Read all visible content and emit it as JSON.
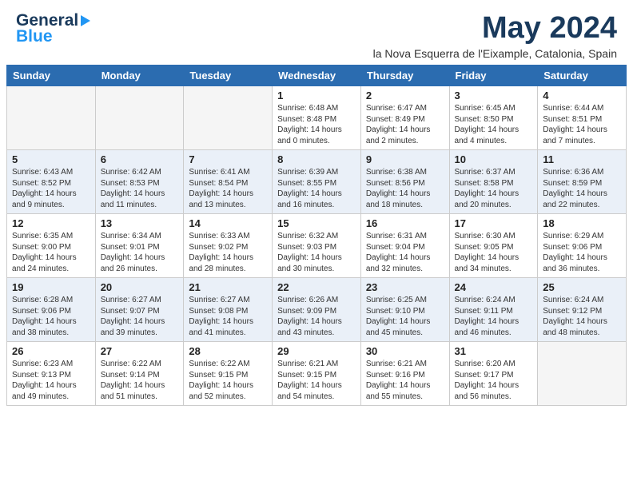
{
  "header": {
    "logo_line1": "General",
    "logo_line2": "Blue",
    "month_year": "May 2024",
    "location": "la Nova Esquerra de l'Eixample, Catalonia, Spain"
  },
  "days_of_week": [
    "Sunday",
    "Monday",
    "Tuesday",
    "Wednesday",
    "Thursday",
    "Friday",
    "Saturday"
  ],
  "weeks": [
    [
      {
        "num": "",
        "info": ""
      },
      {
        "num": "",
        "info": ""
      },
      {
        "num": "",
        "info": ""
      },
      {
        "num": "1",
        "info": "Sunrise: 6:48 AM\nSunset: 8:48 PM\nDaylight: 14 hours\nand 0 minutes."
      },
      {
        "num": "2",
        "info": "Sunrise: 6:47 AM\nSunset: 8:49 PM\nDaylight: 14 hours\nand 2 minutes."
      },
      {
        "num": "3",
        "info": "Sunrise: 6:45 AM\nSunset: 8:50 PM\nDaylight: 14 hours\nand 4 minutes."
      },
      {
        "num": "4",
        "info": "Sunrise: 6:44 AM\nSunset: 8:51 PM\nDaylight: 14 hours\nand 7 minutes."
      }
    ],
    [
      {
        "num": "5",
        "info": "Sunrise: 6:43 AM\nSunset: 8:52 PM\nDaylight: 14 hours\nand 9 minutes."
      },
      {
        "num": "6",
        "info": "Sunrise: 6:42 AM\nSunset: 8:53 PM\nDaylight: 14 hours\nand 11 minutes."
      },
      {
        "num": "7",
        "info": "Sunrise: 6:41 AM\nSunset: 8:54 PM\nDaylight: 14 hours\nand 13 minutes."
      },
      {
        "num": "8",
        "info": "Sunrise: 6:39 AM\nSunset: 8:55 PM\nDaylight: 14 hours\nand 16 minutes."
      },
      {
        "num": "9",
        "info": "Sunrise: 6:38 AM\nSunset: 8:56 PM\nDaylight: 14 hours\nand 18 minutes."
      },
      {
        "num": "10",
        "info": "Sunrise: 6:37 AM\nSunset: 8:58 PM\nDaylight: 14 hours\nand 20 minutes."
      },
      {
        "num": "11",
        "info": "Sunrise: 6:36 AM\nSunset: 8:59 PM\nDaylight: 14 hours\nand 22 minutes."
      }
    ],
    [
      {
        "num": "12",
        "info": "Sunrise: 6:35 AM\nSunset: 9:00 PM\nDaylight: 14 hours\nand 24 minutes."
      },
      {
        "num": "13",
        "info": "Sunrise: 6:34 AM\nSunset: 9:01 PM\nDaylight: 14 hours\nand 26 minutes."
      },
      {
        "num": "14",
        "info": "Sunrise: 6:33 AM\nSunset: 9:02 PM\nDaylight: 14 hours\nand 28 minutes."
      },
      {
        "num": "15",
        "info": "Sunrise: 6:32 AM\nSunset: 9:03 PM\nDaylight: 14 hours\nand 30 minutes."
      },
      {
        "num": "16",
        "info": "Sunrise: 6:31 AM\nSunset: 9:04 PM\nDaylight: 14 hours\nand 32 minutes."
      },
      {
        "num": "17",
        "info": "Sunrise: 6:30 AM\nSunset: 9:05 PM\nDaylight: 14 hours\nand 34 minutes."
      },
      {
        "num": "18",
        "info": "Sunrise: 6:29 AM\nSunset: 9:06 PM\nDaylight: 14 hours\nand 36 minutes."
      }
    ],
    [
      {
        "num": "19",
        "info": "Sunrise: 6:28 AM\nSunset: 9:06 PM\nDaylight: 14 hours\nand 38 minutes."
      },
      {
        "num": "20",
        "info": "Sunrise: 6:27 AM\nSunset: 9:07 PM\nDaylight: 14 hours\nand 39 minutes."
      },
      {
        "num": "21",
        "info": "Sunrise: 6:27 AM\nSunset: 9:08 PM\nDaylight: 14 hours\nand 41 minutes."
      },
      {
        "num": "22",
        "info": "Sunrise: 6:26 AM\nSunset: 9:09 PM\nDaylight: 14 hours\nand 43 minutes."
      },
      {
        "num": "23",
        "info": "Sunrise: 6:25 AM\nSunset: 9:10 PM\nDaylight: 14 hours\nand 45 minutes."
      },
      {
        "num": "24",
        "info": "Sunrise: 6:24 AM\nSunset: 9:11 PM\nDaylight: 14 hours\nand 46 minutes."
      },
      {
        "num": "25",
        "info": "Sunrise: 6:24 AM\nSunset: 9:12 PM\nDaylight: 14 hours\nand 48 minutes."
      }
    ],
    [
      {
        "num": "26",
        "info": "Sunrise: 6:23 AM\nSunset: 9:13 PM\nDaylight: 14 hours\nand 49 minutes."
      },
      {
        "num": "27",
        "info": "Sunrise: 6:22 AM\nSunset: 9:14 PM\nDaylight: 14 hours\nand 51 minutes."
      },
      {
        "num": "28",
        "info": "Sunrise: 6:22 AM\nSunset: 9:15 PM\nDaylight: 14 hours\nand 52 minutes."
      },
      {
        "num": "29",
        "info": "Sunrise: 6:21 AM\nSunset: 9:15 PM\nDaylight: 14 hours\nand 54 minutes."
      },
      {
        "num": "30",
        "info": "Sunrise: 6:21 AM\nSunset: 9:16 PM\nDaylight: 14 hours\nand 55 minutes."
      },
      {
        "num": "31",
        "info": "Sunrise: 6:20 AM\nSunset: 9:17 PM\nDaylight: 14 hours\nand 56 minutes."
      },
      {
        "num": "",
        "info": ""
      }
    ]
  ]
}
